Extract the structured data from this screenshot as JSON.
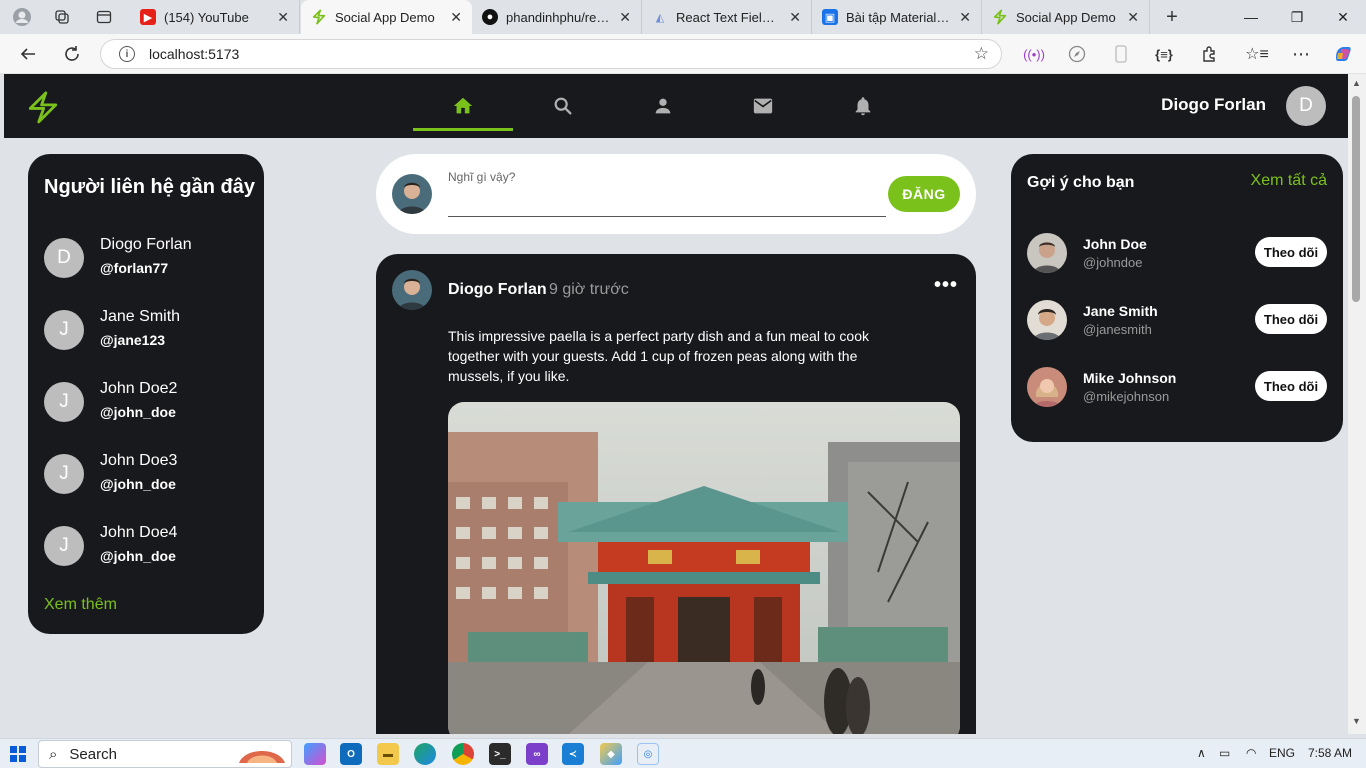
{
  "browser": {
    "tabs": [
      {
        "title": "(154) YouTube",
        "favicon": "youtube-icon",
        "color": "#e62117"
      },
      {
        "title": "Social App Demo",
        "favicon": "bolt-icon",
        "color": "#7bc11c",
        "active": true
      },
      {
        "title": "phandinhphu/react-",
        "favicon": "github-icon",
        "color": "#111111"
      },
      {
        "title": "React Text Field com",
        "favicon": "mui-icon",
        "color": "#6e8fd6"
      },
      {
        "title": "Bài tập Material UI",
        "favicon": "contact-icon",
        "color": "#1a73e8"
      },
      {
        "title": "Social App Demo",
        "favicon": "bolt-icon",
        "color": "#7bc11c"
      }
    ],
    "url": "localhost:5173"
  },
  "appbar": {
    "nav_tabs": [
      "home",
      "search",
      "profile",
      "messages",
      "notifications"
    ],
    "active_tab": "home",
    "user_name": "Diogo Forlan",
    "user_initial": "D",
    "accent": "#7bc11c"
  },
  "contacts": {
    "title": "Người liên hệ gần đây",
    "items": [
      {
        "initial": "D",
        "name": "Diogo Forlan",
        "handle": "@forlan77"
      },
      {
        "initial": "J",
        "name": "Jane Smith",
        "handle": "@jane123"
      },
      {
        "initial": "J",
        "name": "John Doe2",
        "handle": "@john_doe"
      },
      {
        "initial": "J",
        "name": "John Doe3",
        "handle": "@john_doe"
      },
      {
        "initial": "J",
        "name": "John Doe4",
        "handle": "@john_doe"
      }
    ],
    "more": "Xem thêm"
  },
  "composer": {
    "label": "Nghĩ gì vậy?",
    "button": "ĐĂNG"
  },
  "post": {
    "author": "Diogo Forlan",
    "time": "9 giờ trước",
    "menu": "•••",
    "body": "This impressive paella is a perfect party dish and a fun meal to cook together with your guests. Add 1 cup of frozen peas along with the mussels, if you like."
  },
  "suggestions": {
    "title": "Gợi ý cho bạn",
    "see_all": "Xem tất cả",
    "follow_label": "Theo dõi",
    "items": [
      {
        "name": "John Doe",
        "handle": "@johndoe"
      },
      {
        "name": "Jane Smith",
        "handle": "@janesmith"
      },
      {
        "name": "Mike Johnson",
        "handle": "@mikejohnson"
      }
    ]
  },
  "taskbar": {
    "search_label": "Search",
    "language": "ENG",
    "time": "7:58 AM"
  }
}
